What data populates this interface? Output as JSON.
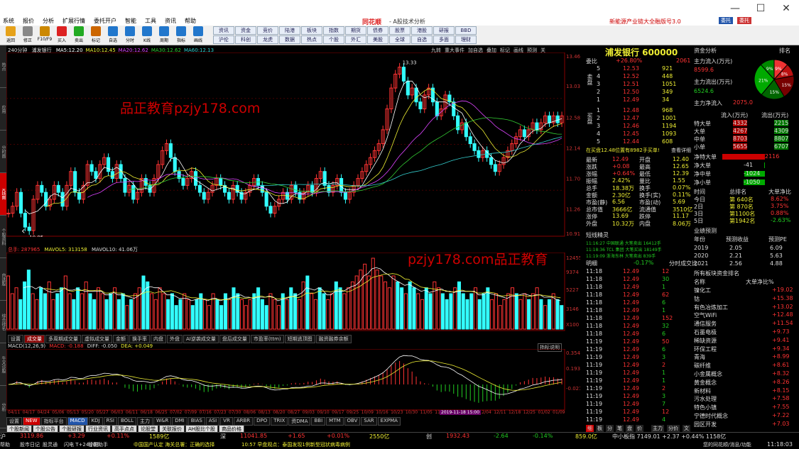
{
  "titlebar": {
    "menu": [
      "系统",
      "报价",
      "分析",
      "扩展行情",
      "委托开户",
      "智能",
      "工具",
      "资讯",
      "帮助"
    ],
    "brand": "同花顺",
    "subtitle": "- A股技术分析",
    "ad1": "新能源产业链大全",
    "ad2": "融版号3.0",
    "btn_trade": "委托",
    "btn_more": "委托",
    "minimize": "—",
    "maximize": "☐",
    "close": "✕"
  },
  "toolbar": {
    "buttons": [
      "返回",
      "修正",
      "F10/F9",
      "买入",
      "卖出",
      "标记",
      "自选",
      "分时",
      "K线",
      "周期",
      "指标",
      "画线"
    ],
    "small_buttons": [
      "资讯",
      "资金",
      "竞价",
      "陆港",
      "板块",
      "指数",
      "期货",
      "债券",
      "股票",
      "港股",
      "研报",
      "BBD",
      "沪伦",
      "科创",
      "龙虎",
      "数据",
      "热点",
      "个股",
      "外汇",
      "美股",
      "全球",
      "自选",
      "多面",
      "理财"
    ]
  },
  "lefttabs": [
    "热点",
    "应用",
    "分时图",
    "K线图",
    "个股资料",
    "自选股",
    "综合排名",
    "牛叉诊股",
    "分析"
  ],
  "chart": {
    "period": "240分钟",
    "stock": "浦发银行",
    "ma": [
      {
        "label": "MA5:",
        "value": "12.20"
      },
      {
        "label": "MA10:",
        "value": "12.45"
      },
      {
        "label": "MA20:",
        "value": "12.62"
      },
      {
        "label": "MA30:",
        "value": "12.62"
      },
      {
        "label": "MA60:",
        "value": "12.13"
      }
    ],
    "right_tools": [
      "九转",
      "重大事件",
      "加自选",
      "叠加",
      "标记",
      "画线",
      "预测",
      "关"
    ],
    "yticks": [
      "13.46",
      "13.03",
      "12.58",
      "12.14",
      "11.70",
      "11.26",
      "10.91"
    ],
    "high_label": "13.33",
    "low_label": "10.95",
    "vol_info": "总手: 287965",
    "volma5": "MAVOL5: 313158",
    "volma10": "MAVOL10: 41.06万",
    "vol_yticks": [
      "12455",
      "9374",
      "5227",
      "3146",
      "X100"
    ],
    "vol_tabs": [
      "设置",
      "成交量",
      "多周期成交量",
      "虚拟成交量",
      "金额",
      "换手率",
      "内盘",
      "外盘",
      "AI逆袭成交量",
      "盘后成交量",
      "市盈率(ttm)",
      "短期逃顶图",
      "融资融券余额"
    ],
    "macd_info": "MACD(12,26,9)",
    "macd_val": "MACD: -0.188",
    "diff_val": "DIFF: -0.050",
    "dea_val": "DEA: +0.049",
    "macd_button": "指标说明",
    "macd_yticks": [
      "0.354",
      "0.193",
      "-0.021"
    ],
    "dates": [
      "04/11",
      "04/17",
      "04/24",
      "05/06",
      "05/13",
      "05/20",
      "05/27",
      "06/03",
      "06/11",
      "06/18",
      "06/25",
      "07/02",
      "07/09",
      "07/16",
      "07/23",
      "07/30",
      "08/06",
      "08/13",
      "08/20",
      "08/27",
      "09/03",
      "09/10",
      "09/17",
      "09/25",
      "10/09",
      "10/16",
      "10/23",
      "10/30",
      "11/05",
      "11/12",
      "11/19",
      "11/26",
      "12/04",
      "12/11",
      "12/18",
      "12/25",
      "01/02",
      "01/09"
    ],
    "highlight_date": "2019-11-18 15:00",
    "ind_tabs": [
      "设置",
      "NEW",
      "指标平台",
      "MACD",
      "KDJ",
      "RSI",
      "BOLL",
      "主力",
      "W&R",
      "DMI",
      "BIAS",
      "ASI",
      "VR",
      "ARBR",
      "DPO",
      "TRIX",
      "资DMA",
      "BBI",
      "MTM",
      "OBV",
      "SAR",
      "EXPMA"
    ],
    "sub_tabs": [
      "个股新闻",
      "个股公告",
      "个股研报",
      "行业资讯",
      "高手点点",
      "论股堂",
      "关联报价",
      "AH股比个股",
      "商品价格"
    ],
    "watermark1": "品正教育pzjy178.com",
    "watermark2": "pzjy178.com品正教育",
    "prices": [
      11.2,
      11.3,
      11.5,
      11.2,
      11.0,
      10.95,
      11.4,
      11.6,
      11.5,
      11.3,
      11.4,
      11.6,
      11.5,
      11.3,
      11.6,
      11.8,
      11.5,
      11.4,
      11.6,
      11.9,
      11.8,
      11.7,
      11.9,
      12.0,
      11.8,
      11.7,
      11.9,
      11.7,
      11.5,
      11.6,
      11.4,
      11.5,
      11.7,
      11.6,
      11.5,
      11.7,
      11.9,
      12.1,
      12.2,
      12.0,
      11.8,
      11.7,
      11.6,
      11.7,
      11.8,
      11.6,
      11.5,
      11.4,
      11.5,
      11.6,
      11.7,
      11.6,
      11.5,
      11.4,
      11.6,
      11.5,
      11.4,
      11.5,
      11.6,
      11.7,
      11.6,
      11.5,
      11.3,
      11.2,
      11.3,
      11.4,
      11.5,
      11.4,
      11.6,
      11.5,
      11.4,
      11.5,
      11.6,
      11.5,
      11.7,
      11.8,
      11.6,
      11.5,
      11.6,
      11.7,
      11.5,
      11.4,
      11.5,
      11.6,
      11.7,
      11.8,
      11.9,
      12.0,
      12.1,
      12.2,
      12.4,
      12.7,
      13.0,
      13.2,
      13.3,
      13.1,
      12.9,
      13.0,
      12.8,
      12.7,
      12.9,
      13.0,
      12.8,
      12.6,
      12.7,
      12.9,
      12.8,
      12.6,
      12.4,
      12.5,
      12.3,
      12.2,
      12.1,
      12.0,
      12.1,
      12.0,
      11.9,
      11.8,
      11.9,
      12.0,
      12.1,
      12.2,
      12.3,
      12.4,
      12.3,
      12.4,
      12.5,
      12.4,
      12.5,
      12.6,
      12.5,
      12.6,
      12.5,
      12.6
    ],
    "volumes": [
      9,
      6,
      7,
      5,
      8,
      10,
      6,
      5,
      7,
      6,
      8,
      5,
      6,
      7,
      9,
      6,
      5,
      7,
      6,
      8,
      6,
      5,
      7,
      6,
      5,
      6,
      7,
      5,
      6,
      4,
      5,
      6,
      7,
      9,
      8,
      6,
      5,
      7,
      6,
      5,
      6,
      4,
      5,
      6,
      5,
      4,
      5,
      6,
      5,
      4,
      6,
      5,
      4,
      6,
      5,
      7,
      6,
      5,
      4,
      5,
      6,
      7,
      5,
      4,
      6,
      5,
      4,
      6,
      5,
      7,
      6,
      5,
      8,
      9,
      6,
      5,
      7,
      6,
      5,
      6,
      8,
      7,
      6,
      7,
      8,
      9,
      10,
      11,
      9,
      12,
      10,
      9,
      8,
      7,
      9,
      8,
      7,
      6,
      8,
      7,
      6,
      5,
      7,
      6,
      8,
      7,
      6,
      5,
      6,
      7,
      8,
      6,
      5,
      6,
      7,
      5,
      6,
      7,
      5,
      6,
      4,
      5,
      6,
      7,
      6,
      5,
      6,
      5,
      6,
      7,
      5,
      4,
      5,
      6,
      5,
      4
    ]
  },
  "side": {
    "title": "浦发银行 600000",
    "tab_funds": "资金分析",
    "tab_rank": "排名",
    "webi": "委比",
    "webi_val": "+26.80%",
    "webi_diff": "2061",
    "asks": [
      [
        "5",
        "12.53",
        "921"
      ],
      [
        "4",
        "12.52",
        "448"
      ],
      [
        "3",
        "12.51",
        "1051"
      ],
      [
        "2",
        "12.50",
        "349"
      ],
      [
        "1",
        "12.49",
        "34"
      ]
    ],
    "bids": [
      [
        "1",
        "12.48",
        "968"
      ],
      [
        "2",
        "12.47",
        "1001"
      ],
      [
        "3",
        "12.46",
        "1194"
      ],
      [
        "4",
        "12.45",
        "1093"
      ],
      [
        "5",
        "12.44",
        "608"
      ]
    ],
    "ask_label": "卖盘",
    "bid_label": "买盘",
    "flow_in_label": "主力流入(万元)",
    "flow_in": "8599.6",
    "flow_out_label": "主力流出(万元)",
    "flow_out": "6524.6",
    "net_label": "主力净流入",
    "net_val": "2075.0",
    "pie": [
      {
        "v": "9%",
        "c": "#e33"
      },
      {
        "v": "8%",
        "c": "#b11"
      },
      {
        "v": "15%",
        "c": "#700"
      },
      {
        "v": "15%",
        "c": "#060"
      },
      {
        "v": "21%",
        "c": "#0a0"
      },
      {
        "v": "9%",
        "c": "#080"
      }
    ],
    "flow_hdr": [
      "流入(万元)",
      "流出(万元)"
    ],
    "flow_rows": [
      [
        "特大单",
        "4332",
        "2215"
      ],
      [
        "大单",
        "4267",
        "4309"
      ],
      [
        "中单",
        "8703",
        "8807"
      ],
      [
        "小单",
        "5655",
        "6707"
      ]
    ],
    "inner_info": "在买盘12.48位置有8982手买单!",
    "check_label": "查看详细",
    "net_rows": [
      [
        "净特大单",
        "2116"
      ],
      [
        "净大单",
        "-41"
      ],
      [
        "净中单",
        "-1024"
      ],
      [
        "净小单",
        "-1050"
      ]
    ],
    "stats": [
      [
        "最新",
        "12.49",
        "开盘",
        "12.40"
      ],
      [
        "涨跌",
        "+0.08",
        "最高",
        "12.65"
      ],
      [
        "涨幅",
        "+0.64%",
        "最低",
        "12.39"
      ],
      [
        "振幅",
        "2.42%",
        "量比",
        "1.55"
      ],
      [
        "总手",
        "18.38万",
        "换手",
        "0.07%"
      ],
      [
        "金额",
        "2.30亿",
        "换手(实)",
        "0.11%"
      ],
      [
        "市盈(静)",
        "6.56",
        "市盈(动)",
        "5.69"
      ],
      [
        "总市值",
        "3666亿",
        "流通值",
        "3510亿"
      ],
      [
        "涨停",
        "13.69",
        "跌停",
        "11.17"
      ],
      [
        "外盘",
        "10.32万",
        "内盘",
        "8.06万"
      ]
    ],
    "rank_hdr": [
      "时间",
      "总排名",
      "大单净比"
    ],
    "rank_rows": [
      [
        "今日",
        "第 640名",
        "8.62%"
      ],
      [
        "2日",
        "第 870名",
        "3.75%"
      ],
      [
        "3日",
        "第1100名",
        "0.88%"
      ],
      [
        "5日",
        "第1942名",
        "-2.63%"
      ]
    ],
    "forecast_title": "业绩预测",
    "forecast_hdr": [
      "年份",
      "预测收益",
      "预测PE"
    ],
    "forecast_rows": [
      [
        "2019",
        "2.05",
        "6.09"
      ],
      [
        "2020",
        "2.21",
        "5.63"
      ],
      [
        "2021",
        "2.56",
        "4.88"
      ]
    ],
    "sector_title": "所有板块资金排名",
    "sector_hdr": [
      "名称",
      "大单净比%"
    ],
    "sectors": [
      [
        "镍化工",
        "+19.02"
      ],
      [
        "钴",
        "+15.38"
      ],
      [
        "有色冶炼加工",
        "+13.02"
      ],
      [
        "空气WiFi",
        "+12.48"
      ],
      [
        "通信服务",
        "+11.54"
      ],
      [
        "石墨电极",
        "+9.73"
      ],
      [
        "稀缺资源",
        "+9.41"
      ],
      [
        "环保工程",
        "+9.34"
      ],
      [
        "青海",
        "+8.99"
      ],
      [
        "碳纤维",
        "+8.61"
      ],
      [
        "小金属概念",
        "+8.32"
      ],
      [
        "黄金概念",
        "+8.26"
      ],
      [
        "新材料",
        "+8.15"
      ],
      [
        "污水处理",
        "+7.58"
      ],
      [
        "特色小镇",
        "+7.55"
      ],
      [
        "宁德时代概念",
        "+7.22"
      ],
      [
        "园区开发",
        "+7.03"
      ]
    ],
    "tick_title": "短线精灵",
    "tick_events": [
      [
        "11:16:27",
        "中国联通",
        "大笔卖出",
        "16412手"
      ],
      [
        "11:18:36",
        "TCL 集团",
        "大笔买出",
        "18149手"
      ],
      [
        "11:19:09",
        "浙海东林",
        "大笔卖出",
        "839手"
      ]
    ],
    "tick_hdr": [
      "明细",
      "-0.17%",
      "闪电下跌"
    ],
    "tick_detail": "分时成交比",
    "ticks": [
      [
        "11:18",
        "12.49",
        "12"
      ],
      [
        "11:18",
        "12.49",
        "30"
      ],
      [
        "11:18",
        "12.49",
        "1"
      ],
      [
        "11:18",
        "12.49",
        "62"
      ],
      [
        "11:18",
        "12.49",
        "6"
      ],
      [
        "11:18",
        "12.49",
        "1"
      ],
      [
        "11:18",
        "12.49",
        "152"
      ],
      [
        "11:18",
        "12.49",
        "32"
      ],
      [
        "11:18",
        "12.49",
        "6"
      ],
      [
        "11:19",
        "12.49",
        "50"
      ],
      [
        "11:19",
        "12.49",
        "6"
      ],
      [
        "11:19",
        "12.49",
        "3"
      ],
      [
        "11:19",
        "12.49",
        "2"
      ],
      [
        "11:19",
        "12.49",
        "1"
      ],
      [
        "11:19",
        "12.49",
        "1"
      ],
      [
        "11:19",
        "12.49",
        "2"
      ],
      [
        "11:19",
        "12.49",
        "3"
      ],
      [
        "11:19",
        "12.49",
        "7"
      ],
      [
        "11:19",
        "12.49",
        "12"
      ],
      [
        "11:19",
        "12.49",
        "4"
      ]
    ],
    "bottom_tabs": [
      "细",
      "板",
      "分",
      "笔",
      "盘",
      "价",
      "主力",
      "分价",
      "文"
    ]
  },
  "status": {
    "items": [
      [
        "沪",
        "3119.86",
        "+3.29",
        "+0.11%",
        "1589亿"
      ],
      [
        "深",
        "11041.85",
        "+1.65",
        "+0.01%",
        "2550亿"
      ],
      [
        "创",
        "1932.43",
        "-2.64",
        "-0.14%",
        "859.0亿"
      ]
    ],
    "mid": "中小板指 7149.01 +2.37 +0.44% 1158亿",
    "tips": [
      "帮助",
      "股市日记",
      "股灵通",
      "闪电 T+24小时",
      "智能助手",
      "中国国产认定 海关总署：正确的选择",
      "10:57 早盘观点：泰国发现1例新型冠状病毒病例"
    ],
    "right": "您的同花顺/消息/功能",
    "time": "11:18:03"
  }
}
